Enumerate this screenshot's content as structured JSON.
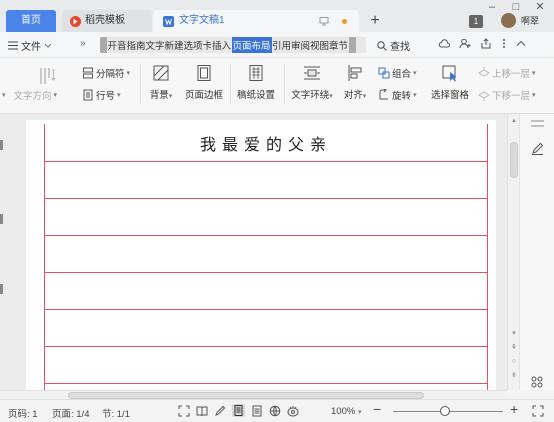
{
  "titlebar": {
    "tab_home": "首页",
    "tab_templates": "稻壳模板",
    "tab_doc": "文字文稿1",
    "username": "啊翠",
    "badge": "1"
  },
  "menubar": {
    "file": "文件",
    "more": "»",
    "tabs": [
      "开始",
      "插入",
      "页面布局",
      "引用",
      "审阅",
      "视图",
      "章节"
    ],
    "tabs_prefix": "开音指南文字新建选项卡插入",
    "active_tab": "页面布局",
    "tabs_suffix": "引用审阅视图章节",
    "search": "查找"
  },
  "ribbon": {
    "text_direction": "文字方向",
    "separator": "分隔符",
    "line_number": "行号",
    "background": "背景",
    "page_border": "页面边框",
    "paper_settings": "稿纸设置",
    "text_wrap": "文字环绕",
    "align": "对齐",
    "group": "组合",
    "rotate": "旋转",
    "selection_pane": "选择窗格",
    "move_up": "上移一层",
    "move_down": "下移一层"
  },
  "document": {
    "title": "我最爱的父亲",
    "accent_color": "#e05060"
  },
  "statusbar": {
    "page_code": "页码: 1",
    "page": "页面: 1/4",
    "section": "节: 1/1",
    "zoom": "100%"
  },
  "colors": {
    "home_tab": "#4a84e8",
    "active_menu": "#3a74d8",
    "grid_line": "#e05060"
  }
}
